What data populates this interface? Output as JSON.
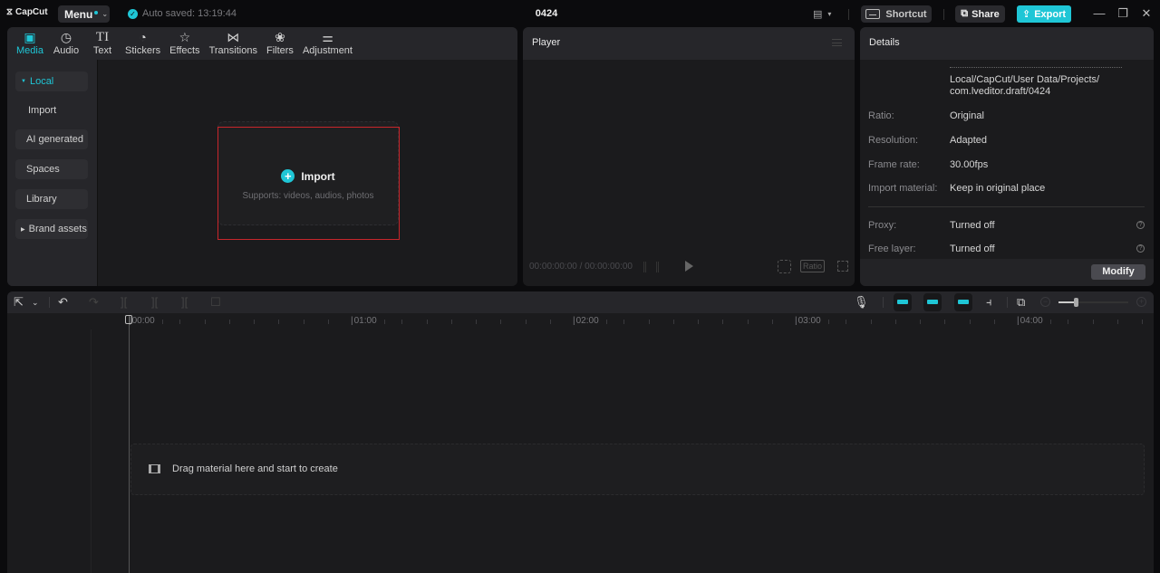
{
  "app": {
    "logo": "CapCut",
    "menu_label": "Menu",
    "autosave": "Auto saved: 13:19:44",
    "project_title": "0424",
    "shortcut_label": "Shortcut",
    "share_label": "Share",
    "export_label": "Export",
    "accent_color": "#1fc6d6",
    "highlight_color": "#c8262b"
  },
  "media": {
    "tabs": [
      {
        "label": "Media",
        "icon": "media-icon",
        "active": true
      },
      {
        "label": "Audio",
        "icon": "audio-icon"
      },
      {
        "label": "Text",
        "icon": "text-icon"
      },
      {
        "label": "Stickers",
        "icon": "stickers-icon"
      },
      {
        "label": "Effects",
        "icon": "effects-icon"
      },
      {
        "label": "Transitions",
        "icon": "transitions-icon"
      },
      {
        "label": "Filters",
        "icon": "filters-icon"
      },
      {
        "label": "Adjustment",
        "icon": "adjustment-icon"
      }
    ],
    "sidebar": [
      {
        "label": "Local",
        "active": true,
        "expanded": true
      },
      {
        "label": "Import"
      },
      {
        "label": "AI generated"
      },
      {
        "label": "Spaces"
      },
      {
        "label": "Library"
      },
      {
        "label": "Brand assets",
        "collapsed": true
      }
    ],
    "import_card": {
      "title": "Import",
      "subtitle": "Supports: videos, audios, photos"
    }
  },
  "player": {
    "title": "Player",
    "timecode": "00:00:00:00 / 00:00:00:00",
    "ratio_label": "Ratio"
  },
  "details": {
    "title": "Details",
    "path_line1": "Local/CapCut/User Data/Projects/",
    "path_line2": "com.lveditor.draft/0424",
    "rows": [
      {
        "label": "Ratio:",
        "value": "Original"
      },
      {
        "label": "Resolution:",
        "value": "Adapted"
      },
      {
        "label": "Frame rate:",
        "value": "30.00fps"
      },
      {
        "label": "Import material:",
        "value": "Keep in original place"
      }
    ],
    "rows2": [
      {
        "label": "Proxy:",
        "value": "Turned off"
      },
      {
        "label": "Free layer:",
        "value": "Turned off"
      }
    ],
    "modify_label": "Modify"
  },
  "timeline": {
    "ruler_labels": [
      "00:00",
      "01:00",
      "02:00",
      "03:00",
      "04:00"
    ],
    "drop_text": "Drag material here and start to create",
    "zoom_level": 0.25
  }
}
